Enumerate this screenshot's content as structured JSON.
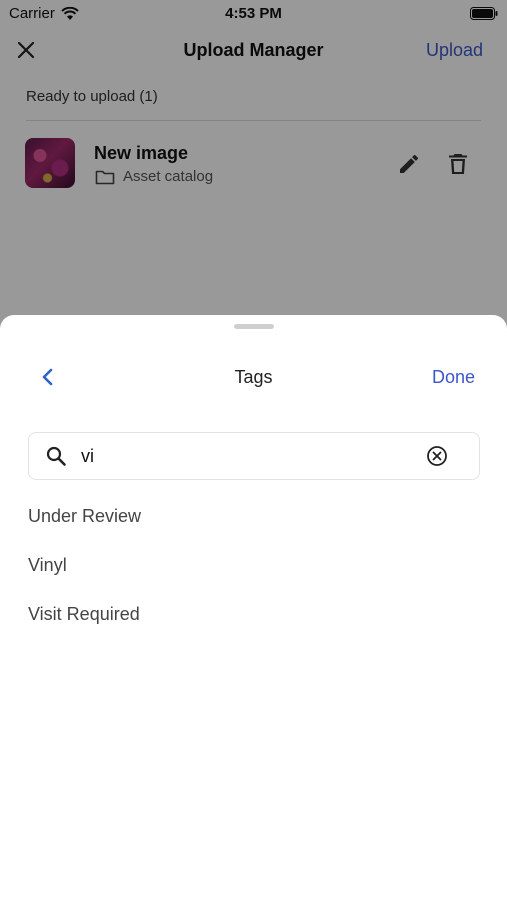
{
  "status": {
    "carrier": "Carrier",
    "time": "4:53 PM"
  },
  "nav": {
    "title": "Upload Manager",
    "upload_label": "Upload"
  },
  "section": {
    "header": "Ready to upload (1)"
  },
  "file": {
    "name": "New image",
    "folder": "Asset catalog"
  },
  "sheet": {
    "title": "Tags",
    "done_label": "Done"
  },
  "search": {
    "value": "vi"
  },
  "results": [
    "Under Review",
    "Vinyl",
    "Visit Required"
  ],
  "colors": {
    "accent": "#3c57c9",
    "overlay": "rgba(0,0,0,0.4)"
  }
}
